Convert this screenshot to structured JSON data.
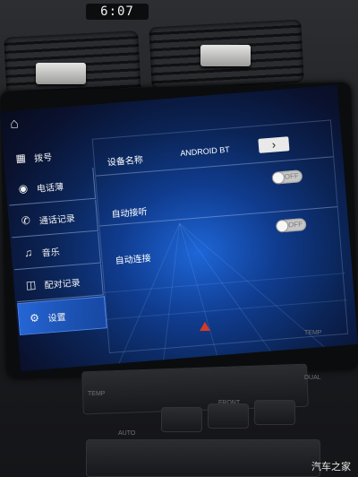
{
  "clock": {
    "time": "6:07"
  },
  "screen": {
    "back_icon": "back-arrow-icon",
    "home_icon": "home-icon",
    "sidebar": {
      "items": [
        {
          "label": "拨号",
          "icon": "keypad-icon"
        },
        {
          "label": "电话薄",
          "icon": "contact-icon"
        },
        {
          "label": "通话记录",
          "icon": "call-log-icon"
        },
        {
          "label": "音乐",
          "icon": "music-icon"
        },
        {
          "label": "配对记录",
          "icon": "pairing-icon"
        },
        {
          "label": "设置",
          "icon": "settings-icon"
        }
      ],
      "active_index": 5
    },
    "settings": {
      "device_name_label": "设备名称",
      "device_name_value": "ANDROID BT",
      "auto_answer_label": "自动接听",
      "auto_answer_toggle": "OFF",
      "auto_connect_label": "自动连接",
      "auto_connect_toggle": "OFF"
    }
  },
  "console": {
    "temp_left": "TEMP",
    "temp_right": "TEMP",
    "front": "FRONT",
    "dual": "DUAL",
    "auto": "AUTO"
  },
  "watermark": "汽车之家",
  "colors": {
    "screen_blue": "#1e66d8",
    "active_item": "#2a6fe6"
  }
}
